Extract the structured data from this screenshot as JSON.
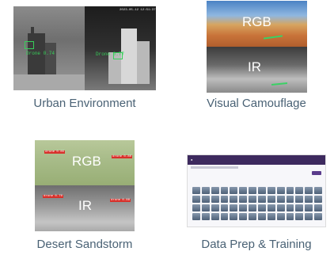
{
  "tiles": [
    {
      "caption": "Urban Environment",
      "detections": [
        "Drone 0.74",
        "Drone 0.77"
      ],
      "timestamp": "2023-05-12 12:51:37"
    },
    {
      "caption": "Visual Camouflage",
      "overlay_top": "RGB",
      "overlay_bottom": "IR"
    },
    {
      "caption": "Desert Sandstorm",
      "overlay_top": "RGB",
      "overlay_bottom": "IR",
      "detections": [
        "drone 0.85",
        "drone 0.80",
        "drone 0.70",
        "drone 0.88"
      ]
    },
    {
      "caption": "Data Prep & Training"
    }
  ],
  "colors": {
    "caption": "#4a6275",
    "detection_green": "#37d05a",
    "detection_red": "#d8302a",
    "dashboard_bar": "#3d2a5e"
  }
}
